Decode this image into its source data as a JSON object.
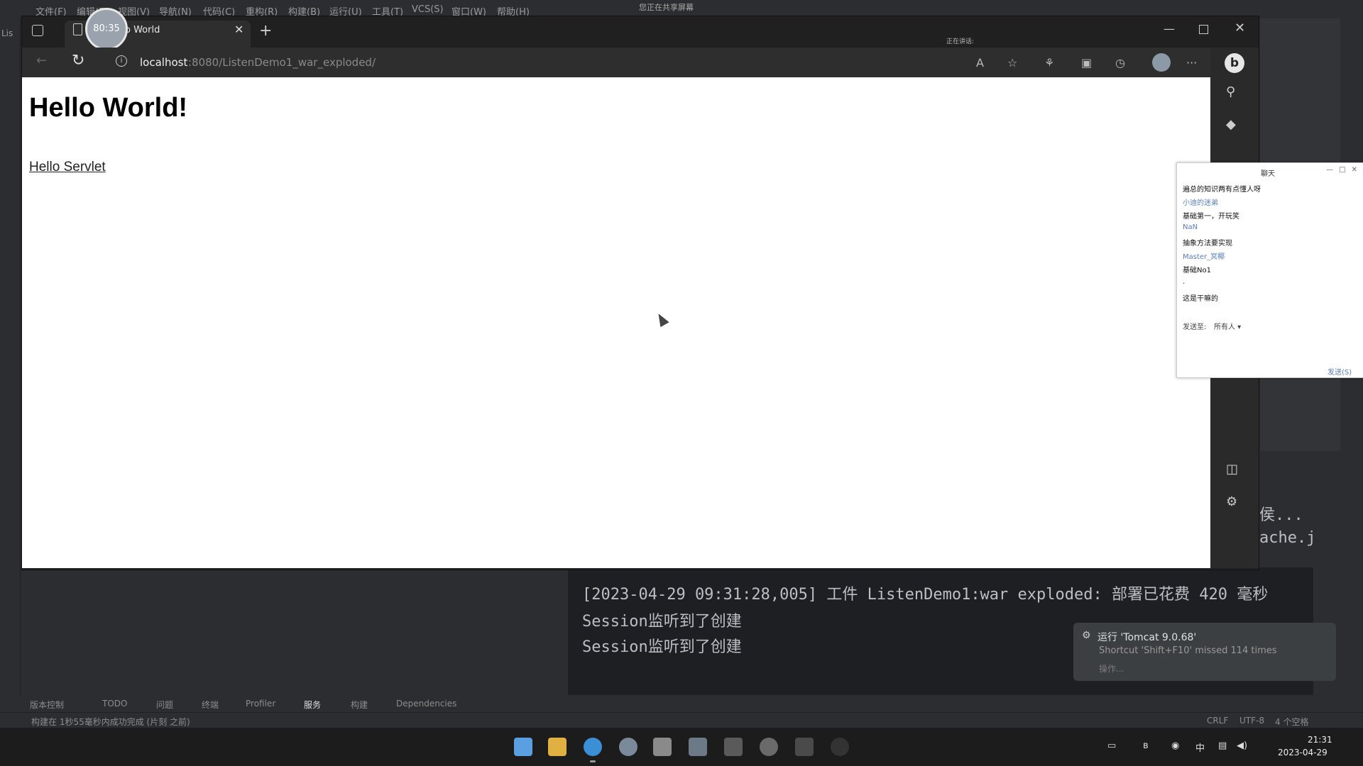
{
  "ide": {
    "title": "您正在共享屏幕",
    "menu": [
      "文件(F)",
      "编辑(E)",
      "视图(V)",
      "导航(N)",
      "代码(C)",
      "重构(R)",
      "构建(B)",
      "运行(U)",
      "工具(T)",
      "VCS(S)",
      "窗口(W)",
      "帮助(H)"
    ],
    "project_tab": "Lis",
    "console": {
      "partial_lines": [
        "侯...",
        "ache.j"
      ],
      "lines": [
        "[2023-04-29 09:31:28,005] 工件 ListenDemo1:war exploded: 部署已花费 420 毫秒",
        "Session监听到了创建",
        "Session监听到了创建"
      ]
    },
    "run_popup": {
      "title": "运行 'Tomcat 9.0.68'",
      "detail": "Shortcut 'Shift+F10' missed 114 times",
      "action": "操作..."
    },
    "tool_tabs": [
      "版本控制",
      "TODO",
      "问题",
      "终端",
      "Profiler",
      "服务",
      "构建",
      "Dependencies"
    ],
    "status_message": "构建在 1秒55毫秒内成功完成 (片刻 之前)",
    "status_right": [
      "CRLF",
      "UTF-8",
      "4 个空格"
    ]
  },
  "browser": {
    "timer": "80:35",
    "tab_title": "Hello World",
    "speaking": "正在讲话:",
    "url_host": "localhost",
    "url_path": ":8080/ListenDemo1_war_exploded/",
    "page": {
      "heading": "Hello World!",
      "link": "Hello Servlet"
    }
  },
  "chat": {
    "title": "聊天",
    "messages": [
      {
        "kind": "text",
        "text": "遍总的知识两有点懂人呀"
      },
      {
        "kind": "name",
        "text": "小迪的迷弟"
      },
      {
        "kind": "text",
        "text": "基础第一，开玩笑"
      },
      {
        "kind": "name",
        "text": "NaN"
      },
      {
        "kind": "text",
        "text": "抽象方法要实现"
      },
      {
        "kind": "name",
        "text": "Master_冥椰"
      },
      {
        "kind": "text",
        "text": "基础No1"
      },
      {
        "kind": "text",
        "text": "."
      },
      {
        "kind": "text",
        "text": "这是干嘛的"
      }
    ],
    "send_to_label": "发送至:",
    "recipient": "所有人 ▾",
    "send_button": "发送(S)"
  },
  "taskbar": {
    "time": "21:31",
    "date": "2023-04-29",
    "ime": "中"
  }
}
